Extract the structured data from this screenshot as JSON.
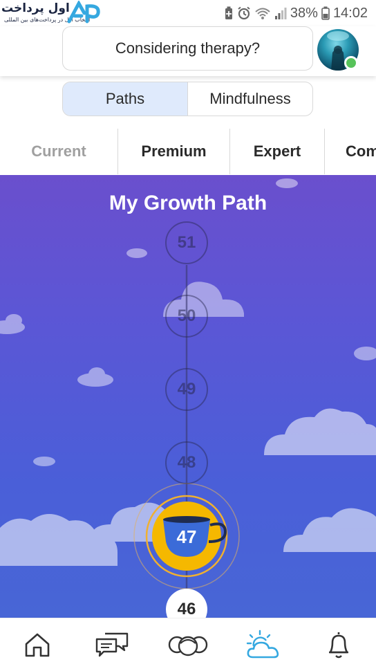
{
  "status_bar": {
    "brand_text": "اول پرداخت",
    "brand_subtext": "انتخاب اول در پرداخت‌های بین المللی",
    "battery": "38%",
    "time": "14:02"
  },
  "header": {
    "therapy_label": "Considering therapy?"
  },
  "segmented": {
    "paths": "Paths",
    "mindfulness": "Mindfulness"
  },
  "categories": {
    "current": "Current",
    "premium": "Premium",
    "expert": "Expert",
    "partial": "Com"
  },
  "scene": {
    "title": "My Growth Path",
    "levels": {
      "l51": "51",
      "l50": "50",
      "l49": "49",
      "l48": "48",
      "l47": "47",
      "l46": "46"
    }
  },
  "bottom_nav": {
    "items": [
      "home-icon",
      "chat-icon",
      "community-icon",
      "weather-icon",
      "bell-icon"
    ],
    "active": "weather-icon"
  },
  "colors": {
    "accent": "#35a8e0",
    "cup_yellow": "#f5b800",
    "cup_blue": "#3b6bd8",
    "online": "#57c35a"
  }
}
